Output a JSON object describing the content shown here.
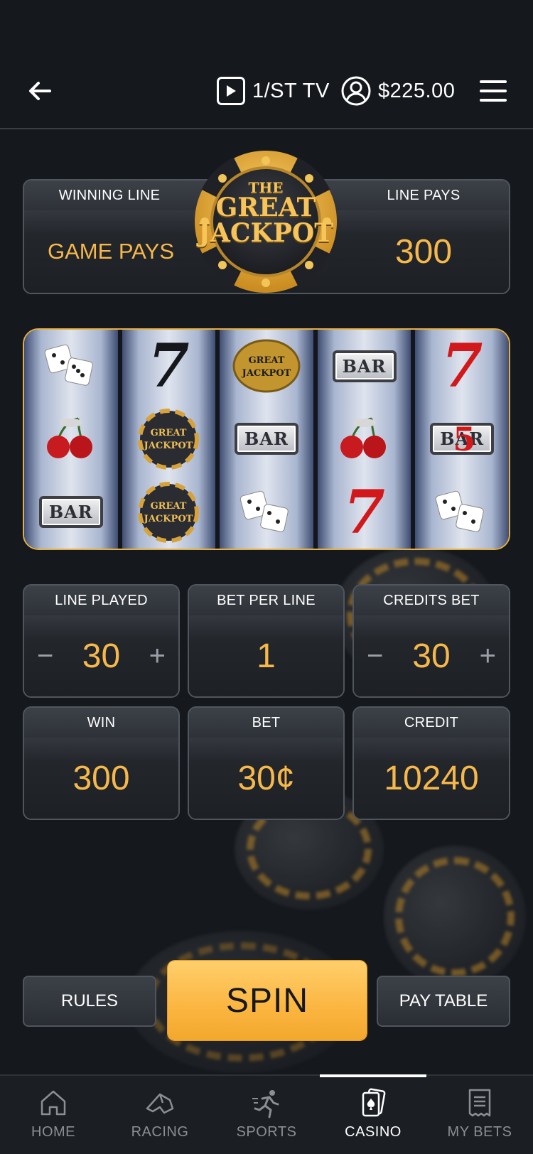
{
  "header": {
    "tv_label": "1/ST TV",
    "balance": "$225.00"
  },
  "game": {
    "logo_lines": [
      "THE",
      "GREAT",
      "JACKPOT"
    ],
    "winning_line_label": "WINNING LINE",
    "winning_line_value": "GAME PAYS",
    "line_pays_label": "LINE PAYS",
    "line_pays_value": "300"
  },
  "reels": {
    "bar_text": "BAR",
    "columns": [
      [
        "dice",
        "cherries",
        "bar"
      ],
      [
        "seven-black",
        "jackpot",
        "jackpot"
      ],
      [
        "jackpot",
        "bar",
        "dice"
      ],
      [
        "bar",
        "cherries",
        "seven-red"
      ],
      [
        "seven-red",
        "bar-seven-red",
        "dice"
      ]
    ]
  },
  "stats": {
    "line_played": {
      "label": "LINE PLAYED",
      "value": "30",
      "minus": "−",
      "plus": "+"
    },
    "bet_per_line": {
      "label": "BET PER LINE",
      "value": "1"
    },
    "credits_bet": {
      "label": "CREDITS BET",
      "value": "30",
      "minus": "−",
      "plus": "+"
    },
    "win": {
      "label": "WIN",
      "value": "300"
    },
    "bet": {
      "label": "BET",
      "value": "30¢"
    },
    "credit": {
      "label": "CREDIT",
      "value": "10240"
    }
  },
  "actions": {
    "rules": "RULES",
    "spin": "SPIN",
    "pay_table": "PAY TABLE"
  },
  "nav": {
    "items": [
      {
        "label": "HOME",
        "icon": "home-icon"
      },
      {
        "label": "RACING",
        "icon": "horse-racing-icon"
      },
      {
        "label": "SPORTS",
        "icon": "running-icon"
      },
      {
        "label": "CASINO",
        "icon": "playing-cards-icon",
        "active": true
      },
      {
        "label": "MY BETS",
        "icon": "receipt-icon"
      }
    ]
  },
  "colors": {
    "accent": "#f7b84b",
    "background": "#15181d",
    "reel_border": "#e5b043"
  }
}
